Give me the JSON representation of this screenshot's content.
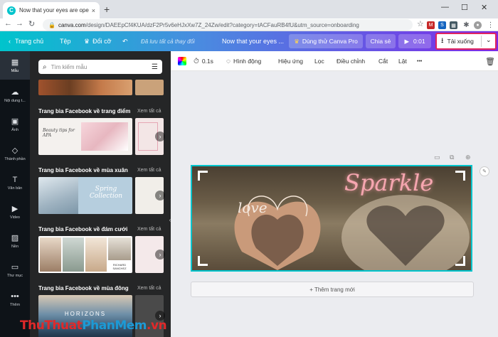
{
  "browser": {
    "tab_title": "Now that your eyes are open, m",
    "tab_close": "×",
    "new_tab": "+",
    "url_host": "canva.com",
    "url_path": "/design/DAEEpCf4KUA/dzF2Pr5v6eHJxXw7Z_24Zw/edit?category=tACFauRB4fU&utm_source=onboarding",
    "min": "—",
    "max": "☐",
    "close": "✕"
  },
  "header": {
    "home": "Trang chủ",
    "file": "Tệp",
    "resize": "Đổi cỡ",
    "saved": "Đã lưu tất cả thay đổi",
    "design_title": "Now that your eyes ...",
    "try_pro": "Dùng thử Canva Pro",
    "share": "Chia sẻ",
    "play_time": "0:01",
    "download": "Tải xuống"
  },
  "rail": [
    {
      "label": "Mẫu",
      "icon": "▦"
    },
    {
      "label": "Nội dung t...",
      "icon": "☁"
    },
    {
      "label": "Ảnh",
      "icon": "▣"
    },
    {
      "label": "Thành phần",
      "icon": "◇"
    },
    {
      "label": "Văn bản",
      "icon": "T"
    },
    {
      "label": "Video",
      "icon": "▶"
    },
    {
      "label": "Nền",
      "icon": "▨"
    },
    {
      "label": "Thư mục",
      "icon": "▭"
    },
    {
      "label": "Thêm",
      "icon": "•••"
    }
  ],
  "panel": {
    "search_placeholder": "Tìm kiếm mẫu",
    "see_all": "Xem tất cả",
    "sections": [
      {
        "title": "Trang bìa Facebook về trang điểm",
        "thumb_text": "Beauty tips for APA"
      },
      {
        "title": "Trang bìa Facebook về mùa xuân",
        "thumb_text": "Spring Collection"
      },
      {
        "title": "Trang bìa Facebook về đám cưới",
        "thumb_text": "RICHARD SANCHEZ"
      },
      {
        "title": "Trang bìa Facebook về mùa đông",
        "thumb_text": "HORIZONS"
      }
    ]
  },
  "toolbar": {
    "duration": "0.1s",
    "animate": "Hình động",
    "effects": "Hiệu ứng",
    "filter": "Lọc",
    "adjust": "Điều chỉnh",
    "crop": "Cắt",
    "flip": "Lật",
    "more": "•••"
  },
  "canvas": {
    "sparkle": "Sparkle",
    "love": "love",
    "add_page": "+ Thêm trang mới"
  },
  "watermark": {
    "part1": "Thu",
    "part2": "Thuat",
    "part3": "PhanMem",
    "part4": ".vn"
  },
  "colors": {
    "accent": "#00c4cc",
    "purple": "#7d2ae8",
    "highlight": "#e0245e"
  }
}
